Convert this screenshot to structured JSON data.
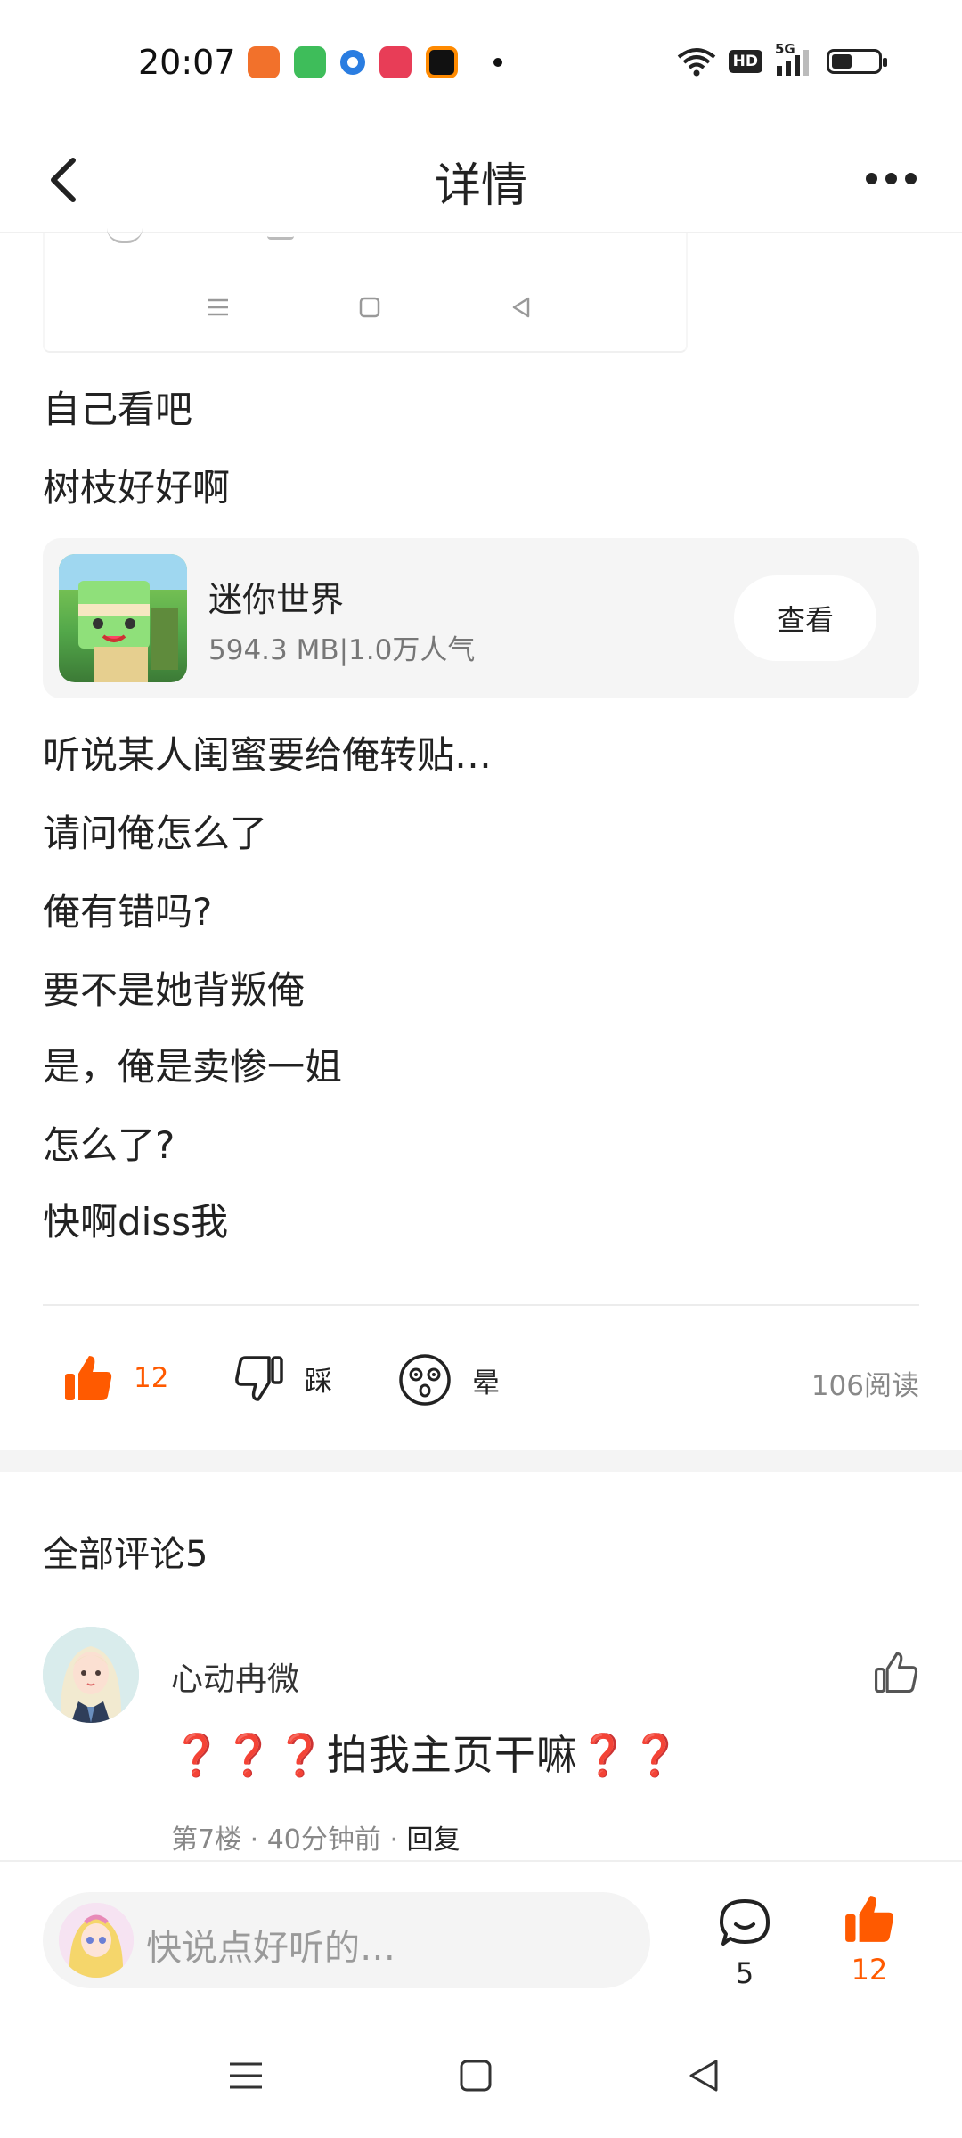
{
  "status_bar": {
    "time": "20:07",
    "app_icon_colors": [
      "#f2712b",
      "#3ebd5a",
      "#2a7de1",
      "#e83d57",
      "#111111"
    ],
    "network": "5G",
    "hd_label": "HD"
  },
  "header": {
    "title": "详情"
  },
  "post": {
    "lines_before_card": [
      "自己看吧",
      "树枝好好啊"
    ],
    "game_card": {
      "name": "迷你世界",
      "meta": "594.3 MB|1.0万人气",
      "button_label": "查看"
    },
    "lines_after_card": [
      "听说某人闺蜜要给俺转贴…",
      "请问俺怎么了",
      "俺有错吗?",
      "要不是她背叛俺",
      "是，俺是卖惨一姐",
      "怎么了?",
      "快啊diss我"
    ]
  },
  "reactions": {
    "like_count": "12",
    "dislike_label": "踩",
    "dizzy_label": "晕",
    "read_count": "106阅读",
    "accent_color": "#ff5a00"
  },
  "comments": {
    "title": "全部评论5",
    "items": [
      {
        "author": "心动冉微",
        "text": "❓❓❓拍我主页干嘛❓❓",
        "floor": "第7楼",
        "time": "40分钟前",
        "reply_label": "回复"
      }
    ]
  },
  "bottom_bar": {
    "input_placeholder": "快说点好听的…",
    "comment_count": "5",
    "like_count": "12"
  }
}
